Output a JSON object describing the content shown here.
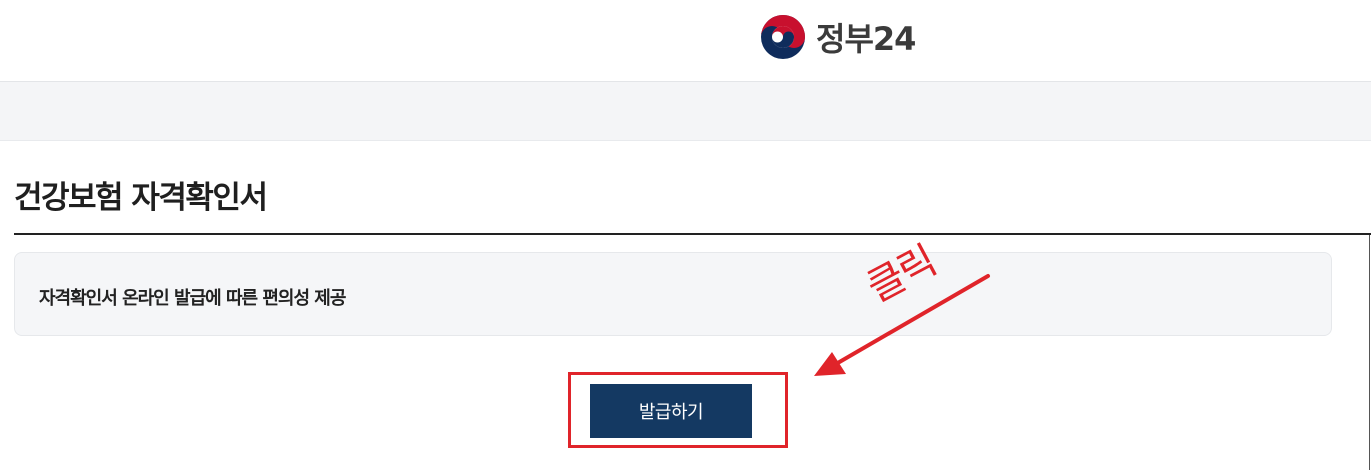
{
  "header": {
    "logo_text": "정부24",
    "logo_icon": "taegeuk-emblem-icon"
  },
  "page": {
    "title": "건강보험 자격확인서"
  },
  "info_box": {
    "text": "자격확인서 온라인 발급에 따른 편의성 제공"
  },
  "actions": {
    "issue_label": "발급하기"
  },
  "annotation": {
    "text": "클릭",
    "color": "#e0242a"
  },
  "colors": {
    "button_bg": "#143962",
    "logo_red": "#c8102e",
    "logo_blue": "#0f2c5c"
  }
}
